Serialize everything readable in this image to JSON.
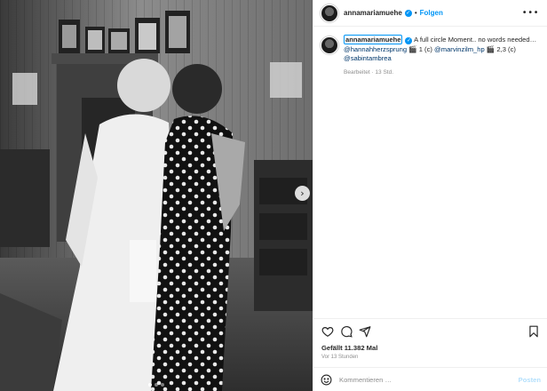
{
  "post": {
    "username": "annamariamuehe",
    "follow_label": "Folgen",
    "separator": "•",
    "more_glyph": "•••"
  },
  "caption": {
    "username": "annamariamuehe",
    "text": "A full circle Moment.. no words needed…",
    "line2": [
      {
        "type": "mention",
        "text": "@hannahherzsprung"
      },
      {
        "type": "text",
        "text": " 🎬 1 (c) "
      },
      {
        "type": "mention",
        "text": "@marvinzilm_hp"
      },
      {
        "type": "text",
        "text": " 🎬 2,3 (c)"
      }
    ],
    "line3_mention": "@sabintambrea",
    "meta": "Bearbeitet · 13 Std."
  },
  "actions": {
    "icons": [
      "heart-icon",
      "comment-icon",
      "share-icon",
      "bookmark-icon"
    ],
    "likes": "Gefällt 11.382 Mal",
    "ago": "Vor 13 Stunden"
  },
  "comment": {
    "placeholder": "Kommentieren …",
    "post_label": "Posten"
  },
  "media": {
    "next_glyph": "›",
    "slide_count": 3,
    "active_slide": 1
  },
  "colors": {
    "accent": "#0095f6",
    "mention": "#00376b",
    "muted": "#8e8e8e",
    "post_disabled": "#b2dffc"
  }
}
